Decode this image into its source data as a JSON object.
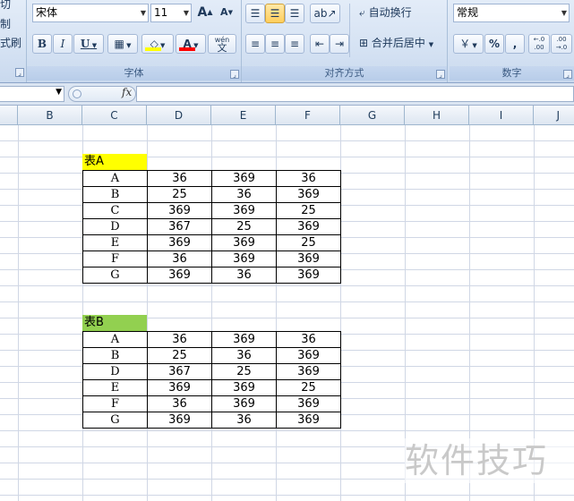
{
  "clipboard": {
    "items": [
      "切",
      "制",
      "式刷"
    ]
  },
  "font": {
    "name": "宋体",
    "size": "11",
    "grow_label": "A",
    "shrink_label": "A",
    "bold_label": "B",
    "italic_label": "I",
    "underline_label": "U",
    "border_label": "▦",
    "fill_label": "◇",
    "color_label": "A",
    "phonetic_top": "wén",
    "phonetic_bottom": "文",
    "group_title": "字体",
    "fill_color": "#ffff00",
    "font_color": "#ff0000"
  },
  "alignment": {
    "wrap_text": "自动换行",
    "merge_center": "合并后居中",
    "group_title": "对齐方式"
  },
  "number": {
    "format": "常规",
    "currency_label": "￥",
    "percent_label": "%",
    "comma_label": ",",
    "inc_decimal_label": "←.0 .00",
    "dec_decimal_label": ".00 →.0",
    "group_title": "数字"
  },
  "formula_bar": {
    "name_box": "",
    "fx_label": "fx",
    "formula": ""
  },
  "columns": [
    "B",
    "C",
    "D",
    "E",
    "F",
    "G",
    "H",
    "I",
    "J"
  ],
  "table_a": {
    "label": "表A",
    "label_color": "#ffff00",
    "rows": [
      [
        "A",
        "36",
        "369",
        "36"
      ],
      [
        "B",
        "25",
        "36",
        "369"
      ],
      [
        "C",
        "369",
        "369",
        "25"
      ],
      [
        "D",
        "367",
        "25",
        "369"
      ],
      [
        "E",
        "369",
        "369",
        "25"
      ],
      [
        "F",
        "36",
        "369",
        "369"
      ],
      [
        "G",
        "369",
        "36",
        "369"
      ]
    ]
  },
  "table_b": {
    "label": "表B",
    "label_color": "#92d050",
    "rows": [
      [
        "A",
        "36",
        "369",
        "36"
      ],
      [
        "B",
        "25",
        "36",
        "369"
      ],
      [
        "D",
        "367",
        "25",
        "369"
      ],
      [
        "E",
        "369",
        "369",
        "25"
      ],
      [
        "F",
        "36",
        "369",
        "369"
      ],
      [
        "G",
        "369",
        "36",
        "369"
      ]
    ]
  },
  "watermark": "软件技巧"
}
